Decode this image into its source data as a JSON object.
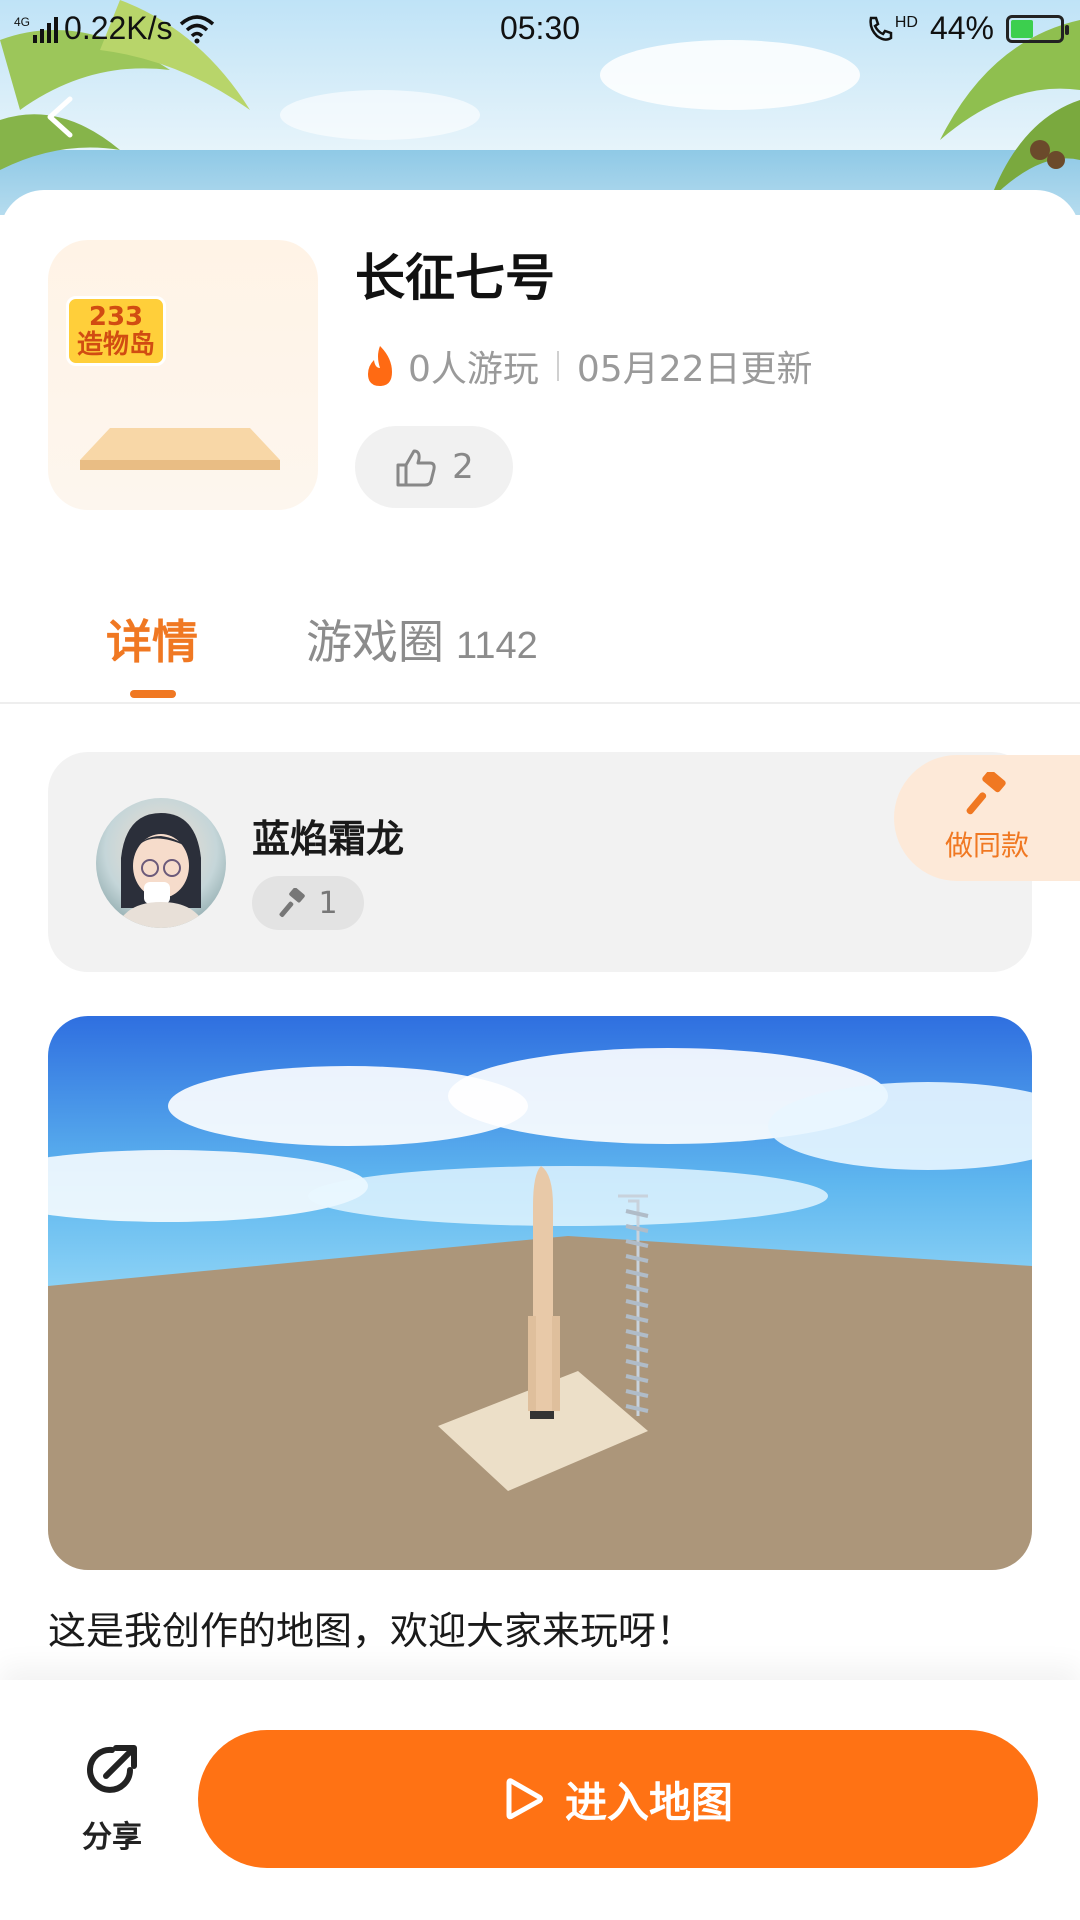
{
  "status_bar": {
    "network": "4G",
    "speed": "0.22K/s",
    "time": "05:30",
    "call_badge": "HD",
    "battery_percent": "44%",
    "battery_level": 0.44
  },
  "game": {
    "title": "长征七号",
    "logo_text": "233\n造物岛",
    "players": "0人游玩",
    "updated": "05月22日更新",
    "likes": "2"
  },
  "tabs": {
    "detail": "详情",
    "circle": "游戏圈",
    "circle_count": "1142"
  },
  "author": {
    "name": "蓝焰霜龙",
    "works_count": "1",
    "make_same_label": "做同款"
  },
  "description": "这是我创作的地图，欢迎大家来玩呀！",
  "bottom_bar": {
    "share_label": "分享",
    "enter_label": "进入地图"
  },
  "colors": {
    "accent": "#ff7214",
    "tab_active": "#f07822"
  },
  "icons": [
    "back-arrow-icon",
    "fire-icon",
    "thumbs-up-icon",
    "hammer-icon",
    "share-icon",
    "play-icon",
    "wifi-icon",
    "signal-icon",
    "battery-icon"
  ]
}
